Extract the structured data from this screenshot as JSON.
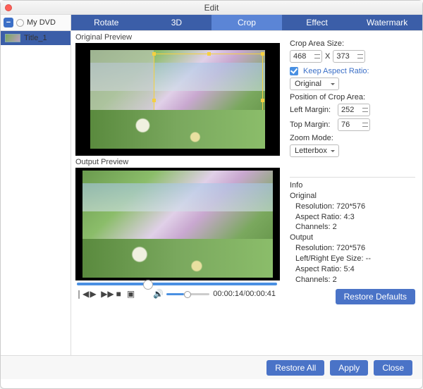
{
  "window": {
    "title": "Edit"
  },
  "dvd": {
    "label": "My DVD"
  },
  "sidebar": {
    "items": [
      {
        "label": "Title_1"
      }
    ]
  },
  "tabs": [
    "Rotate",
    "3D",
    "Crop",
    "Effect",
    "Watermark"
  ],
  "active_tab": "Crop",
  "previews": {
    "original_label": "Original Preview",
    "output_label": "Output Preview"
  },
  "playback": {
    "current": "00:00:14",
    "total": "00:00:41"
  },
  "crop": {
    "size_label": "Crop Area Size:",
    "width": "468",
    "x_sep": "X",
    "height": "373",
    "keep_ratio_label": "Keep Aspect Ratio:",
    "ratio_value": "Original",
    "position_label": "Position of Crop Area:",
    "left_label": "Left Margin:",
    "left_value": "252",
    "top_label": "Top Margin:",
    "top_value": "76",
    "zoom_label": "Zoom Mode:",
    "zoom_value": "Letterbox"
  },
  "info": {
    "heading": "Info",
    "original_heading": "Original",
    "original_resolution": "Resolution: 720*576",
    "original_aspect": "Aspect Ratio: 4:3",
    "original_channels": "Channels: 2",
    "output_heading": "Output",
    "output_resolution": "Resolution: 720*576",
    "output_eyesize": "Left/Right Eye Size: --",
    "output_aspect": "Aspect Ratio: 5:4",
    "output_channels": "Channels: 2"
  },
  "buttons": {
    "restore_defaults": "Restore Defaults",
    "restore_all": "Restore All",
    "apply": "Apply",
    "close": "Close"
  }
}
